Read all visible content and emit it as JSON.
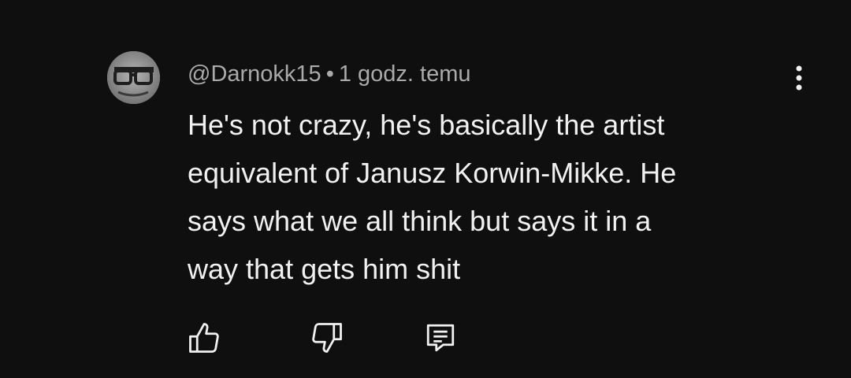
{
  "comment": {
    "author": "@Darnokk15",
    "separator": "•",
    "time": "1 godz. temu",
    "text": "He's not crazy, he's basically the artist\nequivalent of Janusz Korwin-Mikke. He\nsays what we all think but says it in a\nway that gets him shit"
  },
  "icons": {
    "avatar": "avatar-photo",
    "menu": "more-vertical-icon",
    "like": "thumbs-up-icon",
    "dislike": "thumbs-down-icon",
    "reply": "reply-comment-icon"
  },
  "colors": {
    "background": "#0f0f0f",
    "primary_text": "#f1f1f1",
    "secondary_text": "#aaaaaa"
  }
}
